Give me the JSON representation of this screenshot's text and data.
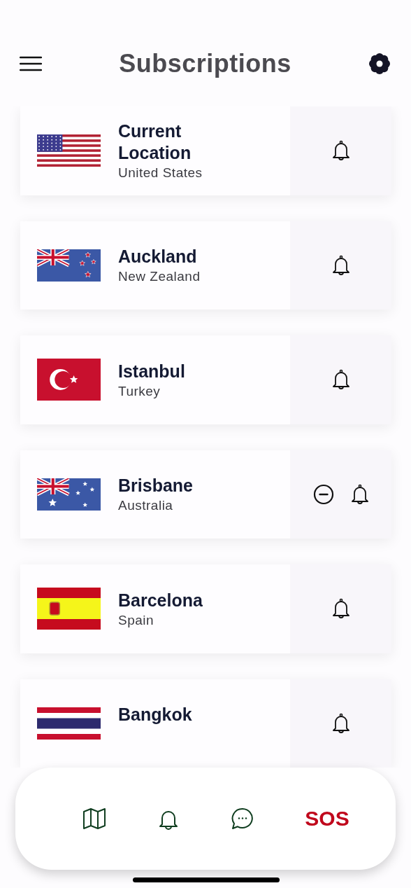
{
  "header": {
    "title": "Subscriptions"
  },
  "subscriptions": [
    {
      "kind": "us",
      "city": "Current Location",
      "country": "United States",
      "removable": false
    },
    {
      "kind": "nz",
      "city": "Auckland",
      "country": "New Zealand",
      "removable": false
    },
    {
      "kind": "tr",
      "city": "Istanbul",
      "country": "Turkey",
      "removable": false
    },
    {
      "kind": "au",
      "city": "Brisbane",
      "country": "Australia",
      "removable": true
    },
    {
      "kind": "es",
      "city": "Barcelona",
      "country": "Spain",
      "removable": false
    },
    {
      "kind": "th",
      "city": "Bangkok",
      "removable": false
    }
  ],
  "tab_bar": {
    "sos_label": "SOS"
  }
}
